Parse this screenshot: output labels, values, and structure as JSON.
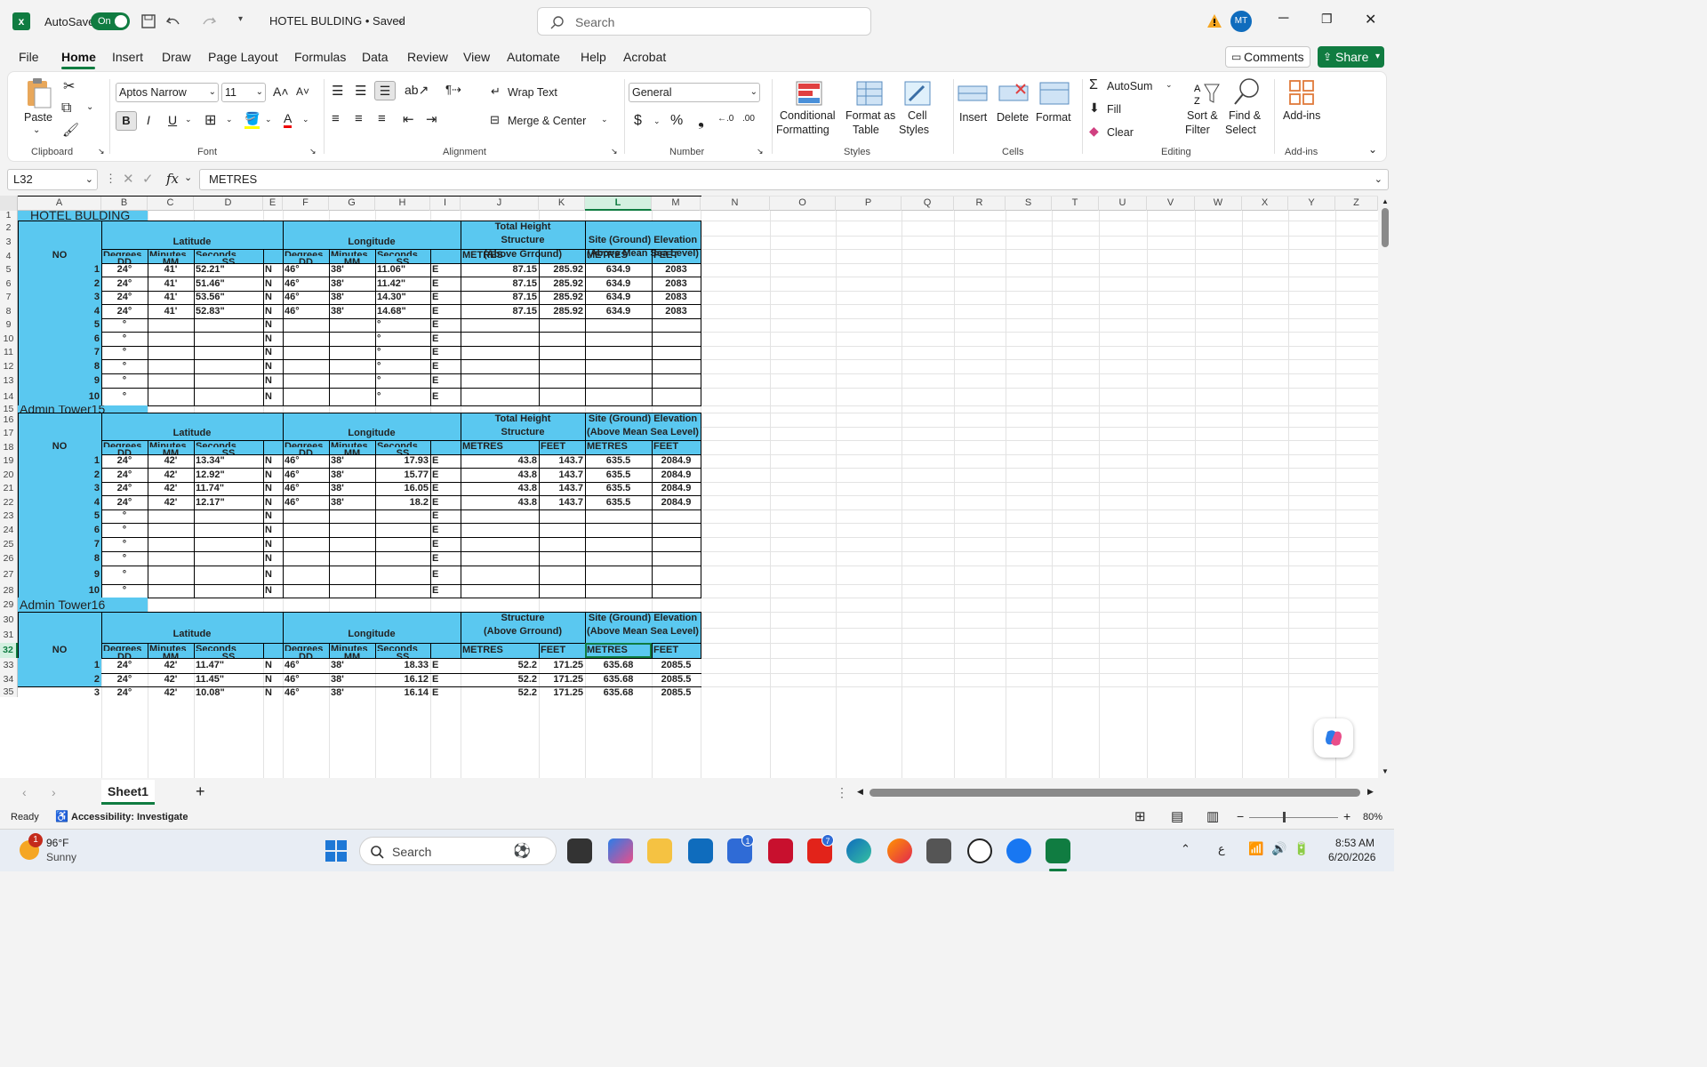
{
  "app": {
    "autosave_label": "AutoSave",
    "autosave_state": "On",
    "doc_title": "HOTEL BULDING • Saved",
    "search_placeholder": "Search",
    "avatar": "MT"
  },
  "menu": [
    "File",
    "Home",
    "Insert",
    "Draw",
    "Page Layout",
    "Formulas",
    "Data",
    "Review",
    "View",
    "Automate",
    "Help",
    "Acrobat"
  ],
  "comments_label": "Comments",
  "share_label": "Share",
  "ribbon": {
    "clipboard": {
      "paste": "Paste",
      "label": "Clipboard"
    },
    "font": {
      "name": "Aptos Narrow",
      "size": "11",
      "label": "Font"
    },
    "alignment": {
      "wrap": "Wrap Text",
      "merge": "Merge & Center",
      "label": "Alignment"
    },
    "number": {
      "format": "General",
      "label": "Number"
    },
    "styles": {
      "cond1": "Conditional",
      "cond2": "Formatting",
      "fmt1": "Format as",
      "fmt2": "Table",
      "cell1": "Cell",
      "cell2": "Styles",
      "label": "Styles"
    },
    "cells": {
      "insert": "Insert",
      "delete": "Delete",
      "format": "Format",
      "label": "Cells"
    },
    "editing": {
      "autosum": "AutoSum",
      "fill": "Fill",
      "clear": "Clear",
      "sort1": "Sort &",
      "sort2": "Filter",
      "find1": "Find &",
      "find2": "Select",
      "label": "Editing"
    },
    "addins": {
      "addins": "Add-ins",
      "label": "Add-ins"
    }
  },
  "formula": {
    "namebox": "L32",
    "fx": "fx",
    "value": "METRES"
  },
  "columns": [
    "A",
    "B",
    "C",
    "D",
    "E",
    "F",
    "G",
    "H",
    "I",
    "J",
    "K",
    "L",
    "M",
    "N",
    "O",
    "P",
    "Q",
    "R",
    "S",
    "T",
    "U",
    "V",
    "W",
    "X",
    "Y",
    "Z"
  ],
  "rows": [
    "1",
    "2",
    "3",
    "4",
    "5",
    "6",
    "7",
    "8",
    "9",
    "10",
    "11",
    "12",
    "13",
    "14",
    "15",
    "16",
    "17",
    "18",
    "19",
    "20",
    "21",
    "22",
    "23",
    "24",
    "25",
    "26",
    "27",
    "28",
    "29",
    "30",
    "31",
    "32",
    "33",
    "34",
    "35"
  ],
  "sheet": {
    "t1_title": "HOTEL BULDING",
    "t2_title": "Admin Tower15",
    "t3_title": "Admin Tower16",
    "hdr": {
      "latitude": "Latitude",
      "longitude": "Longitude",
      "total_height": "Total Height",
      "structure": "Structure",
      "above_grround": "(Above Grround)",
      "site_elev": "Site (Ground) Elevation",
      "above_msl": "(Above Mean Sea Level)",
      "no": "NO",
      "degrees": "Degrees",
      "dd": "DD",
      "minutes": "Minutes",
      "mm": "MM",
      "seconds": "Seconds",
      "ss": "SS",
      "metres": "METRES",
      "feet": "FEET"
    },
    "t1_rows": [
      [
        "1",
        "24°",
        "41'",
        "52.21\"",
        "N",
        "46°",
        "38'",
        "11.06\"",
        "E",
        "87.15",
        "285.92",
        "634.9",
        "2083"
      ],
      [
        "2",
        "24°",
        "41'",
        "51.46\"",
        "N",
        "46°",
        "38'",
        "11.42\"",
        "E",
        "87.15",
        "285.92",
        "634.9",
        "2083"
      ],
      [
        "3",
        "24°",
        "41'",
        "53.56\"",
        "N",
        "46°",
        "38'",
        "14.30\"",
        "E",
        "87.15",
        "285.92",
        "634.9",
        "2083"
      ],
      [
        "4",
        "24°",
        "41'",
        "52.83\"",
        "N",
        "46°",
        "38'",
        "14.68\"",
        "E",
        "87.15",
        "285.92",
        "634.9",
        "2083"
      ],
      [
        "5",
        "°",
        "",
        "",
        "N",
        "",
        "",
        "°",
        "E",
        "",
        "",
        "",
        ""
      ],
      [
        "6",
        "°",
        "",
        "",
        "N",
        "",
        "",
        "°",
        "E",
        "",
        "",
        "",
        ""
      ],
      [
        "7",
        "°",
        "",
        "",
        "N",
        "",
        "",
        "°",
        "E",
        "",
        "",
        "",
        ""
      ],
      [
        "8",
        "°",
        "",
        "",
        "N",
        "",
        "",
        "°",
        "E",
        "",
        "",
        "",
        ""
      ],
      [
        "9",
        "°",
        "",
        "",
        "N",
        "",
        "",
        "°",
        "E",
        "",
        "",
        "",
        ""
      ],
      [
        "10",
        "°",
        "",
        "",
        "N",
        "",
        "",
        "°",
        "E",
        "",
        "",
        "",
        ""
      ]
    ],
    "t2_rows": [
      [
        "1",
        "24°",
        "42'",
        "13.34\"",
        "N",
        "46°",
        "38'",
        "17.93",
        "E",
        "43.8",
        "143.7",
        "635.5",
        "2084.9"
      ],
      [
        "2",
        "24°",
        "42'",
        "12.92\"",
        "N",
        "46°",
        "38'",
        "15.77",
        "E",
        "43.8",
        "143.7",
        "635.5",
        "2084.9"
      ],
      [
        "3",
        "24°",
        "42'",
        "11.74\"",
        "N",
        "46°",
        "38'",
        "16.05",
        "E",
        "43.8",
        "143.7",
        "635.5",
        "2084.9"
      ],
      [
        "4",
        "24°",
        "42'",
        "12.17\"",
        "N",
        "46°",
        "38'",
        "18.2",
        "E",
        "43.8",
        "143.7",
        "635.5",
        "2084.9"
      ],
      [
        "5",
        "°",
        "",
        "",
        "N",
        "",
        "",
        "",
        "E",
        "",
        "",
        "",
        ""
      ],
      [
        "6",
        "°",
        "",
        "",
        "N",
        "",
        "",
        "",
        "E",
        "",
        "",
        "",
        ""
      ],
      [
        "7",
        "°",
        "",
        "",
        "N",
        "",
        "",
        "",
        "E",
        "",
        "",
        "",
        ""
      ],
      [
        "8",
        "°",
        "",
        "",
        "N",
        "",
        "",
        "",
        "E",
        "",
        "",
        "",
        ""
      ],
      [
        "9",
        "°",
        "",
        "",
        "N",
        "",
        "",
        "",
        "E",
        "",
        "",
        "",
        ""
      ],
      [
        "10",
        "°",
        "",
        "",
        "N",
        "",
        "",
        "",
        "E",
        "",
        "",
        "",
        ""
      ]
    ],
    "t3_rows": [
      [
        "1",
        "24°",
        "42'",
        "11.47\"",
        "N",
        "46°",
        "38'",
        "18.33",
        "E",
        "52.2",
        "171.25",
        "635.68",
        "2085.5"
      ],
      [
        "2",
        "24°",
        "42'",
        "11.45\"",
        "N",
        "46°",
        "38'",
        "16.12",
        "E",
        "52.2",
        "171.25",
        "635.68",
        "2085.5"
      ],
      [
        "3",
        "24°",
        "42'",
        "10.08\"",
        "N",
        "46°",
        "38'",
        "16.14",
        "E",
        "52.2",
        "171.25",
        "635.68",
        "2085.5"
      ]
    ]
  },
  "tabs": {
    "sheet1": "Sheet1",
    "add": "+"
  },
  "status": {
    "ready": "Ready",
    "accessibility": "Accessibility: Investigate",
    "zoom": "80%"
  },
  "taskbar": {
    "temp": "96°F",
    "weather": "Sunny",
    "search": "Search",
    "time": "8:53 AM",
    "date": "6/20/2026",
    "weather_badge": "1",
    "badge1": "1",
    "badge7": "7"
  },
  "colors": {
    "accent": "#107c41",
    "cell_blue": "#5ac8f0"
  }
}
